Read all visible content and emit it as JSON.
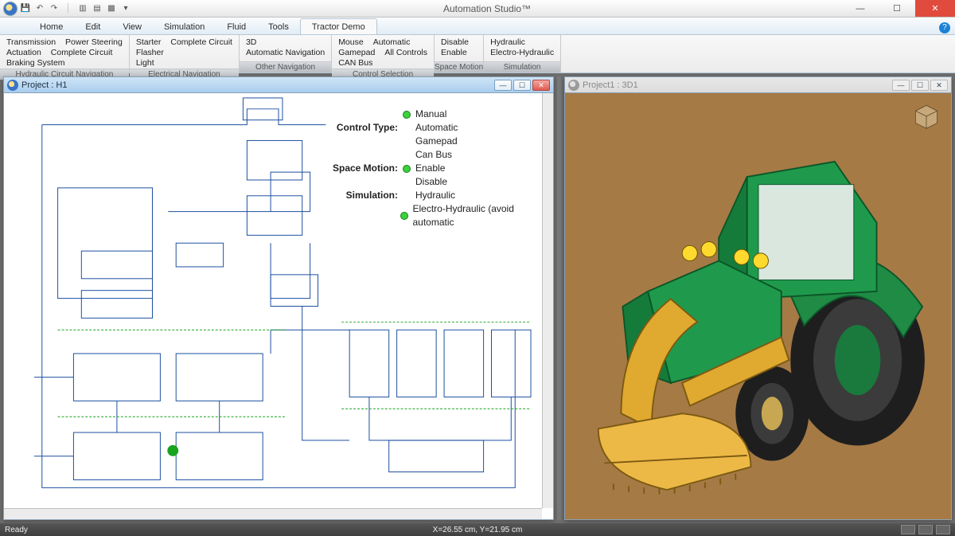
{
  "app": {
    "title": "Automation Studio™"
  },
  "titlebar": {
    "qat": [
      "save",
      "undo",
      "redo",
      "divider",
      "action1",
      "action2",
      "action3",
      "dropdown"
    ]
  },
  "tabs": {
    "items": [
      "Home",
      "Edit",
      "View",
      "Simulation",
      "Fluid",
      "Tools",
      "Tractor Demo"
    ],
    "active": 6
  },
  "ribbon": {
    "groups": [
      {
        "label": "Hydraulic Circuit Navigation",
        "rows": [
          [
            "Transmission",
            "Power Steering"
          ],
          [
            "Actuation",
            "Complete Circuit"
          ],
          [
            "Braking System"
          ]
        ]
      },
      {
        "label": "Electrical Navigation",
        "rows": [
          [
            "Starter",
            "Complete Circuit"
          ],
          [
            "Flasher"
          ],
          [
            "Light"
          ]
        ]
      },
      {
        "label": "Other Navigation",
        "rows": [
          [
            "3D"
          ],
          [
            "Automatic Navigation"
          ]
        ]
      },
      {
        "label": "Control Selection",
        "rows": [
          [
            "Mouse",
            "Automatic"
          ],
          [
            "Gamepad",
            "All Controls"
          ],
          [
            "CAN Bus"
          ]
        ]
      },
      {
        "label": "Space Motion",
        "rows": [
          [
            "Disable"
          ],
          [
            "Enable"
          ]
        ]
      },
      {
        "label": "Simulation",
        "rows": [
          [
            "Hydraulic"
          ],
          [
            "Electro-Hydraulic"
          ]
        ]
      }
    ]
  },
  "left_window": {
    "title": "Project : H1",
    "overlay": {
      "rows": [
        {
          "label": "",
          "dot": "green",
          "text": "Manual"
        },
        {
          "label": "Control Type:",
          "dot": "",
          "text": "Automatic"
        },
        {
          "label": "",
          "dot": "",
          "text": "Gamepad"
        },
        {
          "label": "",
          "dot": "",
          "text": "Can Bus"
        },
        {
          "label": "Space Motion:",
          "dot": "green",
          "text": "Enable"
        },
        {
          "label": "",
          "dot": "",
          "text": "Disable"
        },
        {
          "label": "Simulation:",
          "dot": "",
          "text": "Hydraulic"
        },
        {
          "label": "",
          "dot": "green",
          "text": "Electro-Hydraulic (avoid automatic"
        }
      ]
    }
  },
  "right_window": {
    "title": "Project1 : 3D1"
  },
  "status": {
    "ready": "Ready",
    "coords": "X=26.55 cm, Y=21.95 cm"
  }
}
